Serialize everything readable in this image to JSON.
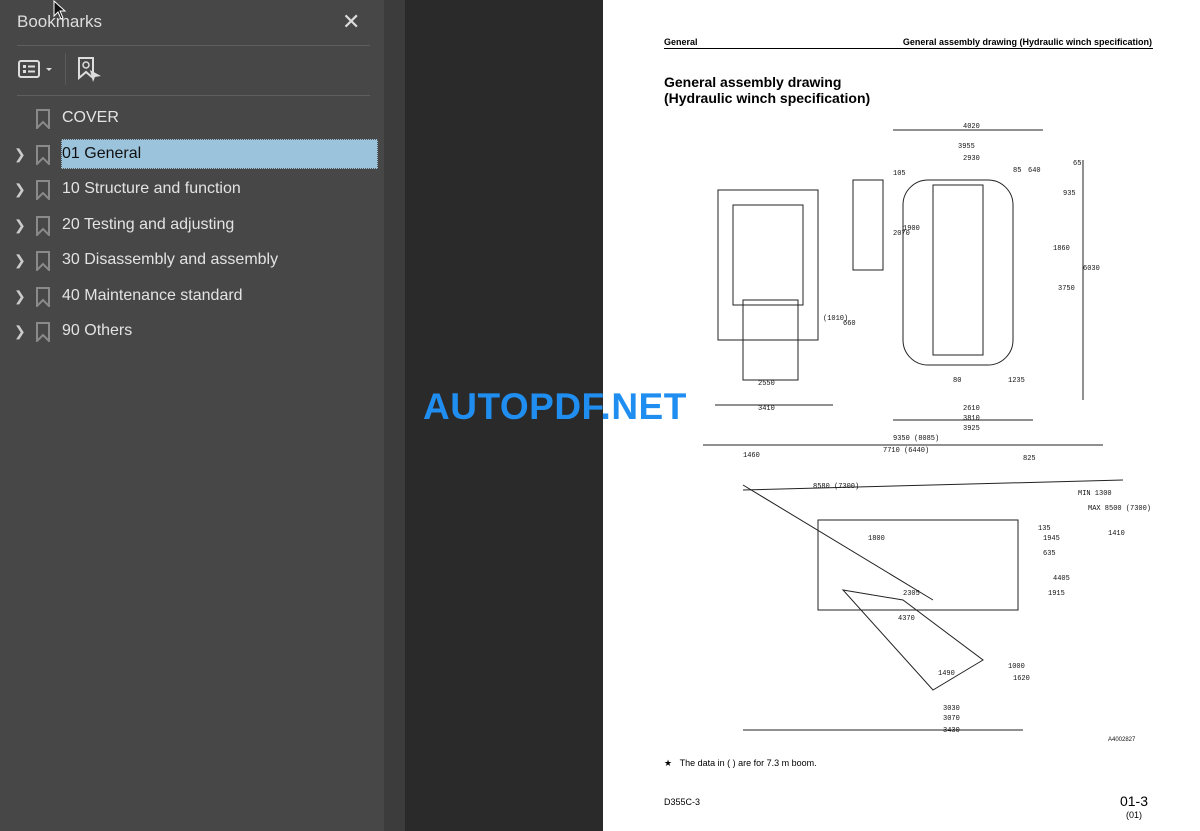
{
  "sidebar": {
    "title": "Bookmarks",
    "close_icon": "close-icon",
    "items": [
      {
        "label": "COVER",
        "expandable": false
      },
      {
        "label": "01 General",
        "expandable": true,
        "selected": true
      },
      {
        "label": "10 Structure and function",
        "expandable": true
      },
      {
        "label": "20 Testing and adjusting",
        "expandable": true
      },
      {
        "label": "30 Disassembly and assembly",
        "expandable": true
      },
      {
        "label": "40 Maintenance standard",
        "expandable": true
      },
      {
        "label": "90 Others",
        "expandable": true
      }
    ]
  },
  "page": {
    "header_left": "General",
    "header_right": "General assembly drawing (Hydraulic winch specification)",
    "title_line1": "General assembly drawing",
    "title_line2": "(Hydraulic winch specification)",
    "drawing_id": "A4002827",
    "dimensions": [
      "4020",
      "3955",
      "2930",
      "105",
      "85",
      "640",
      "65",
      "935",
      "2070",
      "1900",
      "1860",
      "6030",
      "3750",
      "660",
      "(1010)",
      "80",
      "1235",
      "2550",
      "3410",
      "2610",
      "3810",
      "3925",
      "9350 (8085)",
      "7710 (6440)",
      "1460",
      "825",
      "8580 (7300)",
      "MAX 8500 (7300)",
      "MIN 1300",
      "1410",
      "1800",
      "135",
      "1945",
      "635",
      "4405",
      "2305",
      "1915",
      "4370",
      "1490",
      "1000",
      "1620",
      "3030",
      "3070",
      "3430"
    ],
    "note_star": "★",
    "note": "The data in ( ) are for 7.3 m boom.",
    "model": "D355C-3",
    "page_number": "01-3",
    "page_rev": "(01)"
  },
  "watermark": "AUTOPDF.NET",
  "colors": {
    "selection": "#9cc3dc",
    "watermark": "#1f8ef0",
    "sidebar_bg": "#474747"
  }
}
